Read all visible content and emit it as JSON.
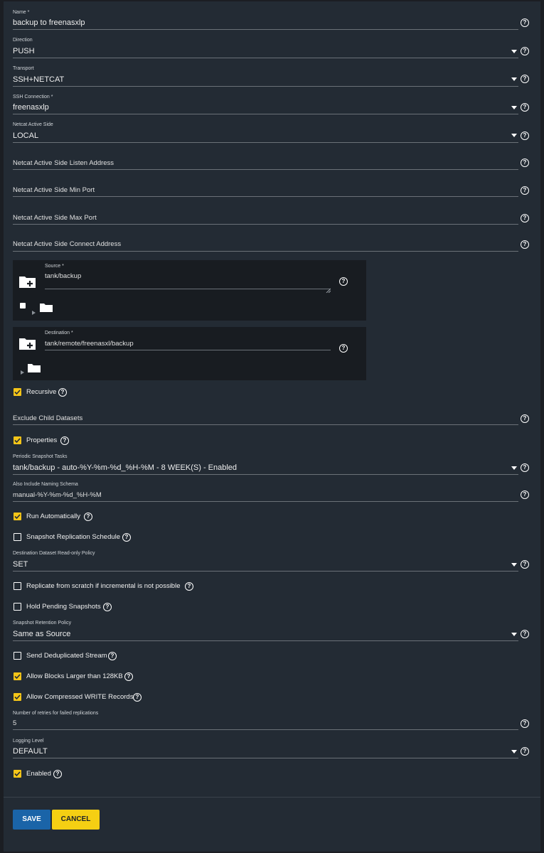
{
  "fields": {
    "name": {
      "label": "Name *",
      "value": "backup to freenasxlp"
    },
    "direction": {
      "label": "Direction",
      "value": "PUSH"
    },
    "transport": {
      "label": "Transport",
      "value": "SSH+NETCAT"
    },
    "ssh_connection": {
      "label": "SSH Connection *",
      "value": "freenasxlp"
    },
    "netcat_active_side": {
      "label": "Netcat Active Side",
      "value": "LOCAL"
    },
    "listen_address": {
      "placeholder": "Netcat Active Side Listen Address"
    },
    "min_port": {
      "placeholder": "Netcat Active Side Min Port"
    },
    "max_port": {
      "placeholder": "Netcat Active Side Max Port"
    },
    "connect_address": {
      "placeholder": "Netcat Active Side Connect Address"
    },
    "exclude_child": {
      "placeholder": "Exclude Child Datasets"
    },
    "periodic_snapshot_tasks": {
      "label": "Periodic Snapshot Tasks",
      "value": "tank/backup - auto-%Y-%m-%d_%H-%M - 8 WEEK(S) - Enabled"
    },
    "naming_schema": {
      "label": "Also Include Naming Schema",
      "value": "manual-%Y-%m-%d_%H-%M"
    },
    "readonly_policy": {
      "label": "Destination Dataset Read-only Policy",
      "value": "SET"
    },
    "retention_policy": {
      "label": "Snapshot Retention Policy",
      "value": "Same as Source"
    },
    "retries": {
      "label": "Number of retries for failed replications",
      "value": "5"
    },
    "logging_level": {
      "label": "Logging Level",
      "value": "DEFAULT"
    }
  },
  "source": {
    "label": "Source *",
    "value": "tank/backup"
  },
  "destination": {
    "label": "Destination *",
    "value": "tank/remote/freenasxl/backup"
  },
  "checkboxes": {
    "recursive": {
      "label": "Recursive",
      "checked": true
    },
    "properties": {
      "label": "Properties",
      "checked": true
    },
    "run_automatically": {
      "label": "Run Automatically",
      "checked": true
    },
    "snapshot_schedule": {
      "label": "Snapshot Replication Schedule",
      "checked": false
    },
    "replicate_scratch": {
      "label": "Replicate from scratch if incremental is not possible",
      "checked": false
    },
    "hold_pending": {
      "label": "Hold Pending Snapshots",
      "checked": false
    },
    "send_dedup": {
      "label": "Send Deduplicated Stream",
      "checked": false
    },
    "allow_large_blocks": {
      "label": "Allow Blocks Larger than 128KB",
      "checked": true
    },
    "allow_compressed": {
      "label": "Allow Compressed WRITE Records",
      "checked": true
    },
    "enabled": {
      "label": "Enabled",
      "checked": true
    }
  },
  "buttons": {
    "save": "SAVE",
    "cancel": "CANCEL"
  },
  "help_glyph": "?",
  "icons": {
    "help": "help-circle-icon",
    "caret": "dropdown-caret-icon",
    "folder": "folder-icon",
    "folder_add": "folder-plus-icon"
  },
  "colors": {
    "accent": "#f5c518",
    "save": "#1a64a8",
    "cancel": "#f5cf13",
    "background": "#232b34"
  }
}
